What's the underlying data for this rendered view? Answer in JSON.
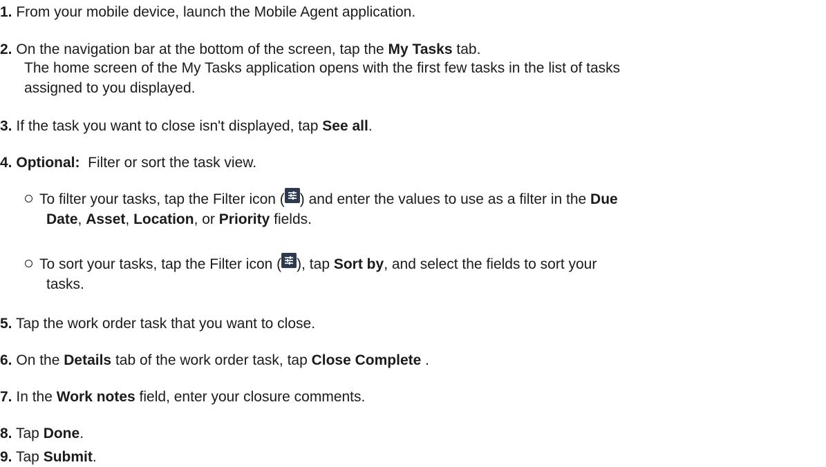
{
  "steps": [
    {
      "number": "1.",
      "parts": [
        "From your mobile device, launch the Mobile Agent application."
      ]
    },
    {
      "number": "2.",
      "pre": "On the navigation bar at the bottom of the screen, tap the ",
      "bold": "My Tasks",
      "post": " tab.",
      "cont1": "The home screen of the My Tasks application opens with the first few tasks in the list of tasks",
      "cont2": "assigned to you displayed."
    },
    {
      "number": "3.",
      "pre": "If the task you want to close isn't displayed, tap ",
      "bold": "See all",
      "post": "."
    },
    {
      "number": "4.",
      "bold": "Optional:",
      "post": "  Filter or sort the task view.",
      "sub": [
        {
          "a": "To filter your tasks, tap the Filter icon (",
          "b": ") and enter the values to use as a filter in the ",
          "b1": "Due",
          "c1": "Date",
          "c2": ", ",
          "c3": "Asset",
          "c4": ", ",
          "c5": "Location",
          "c6": ", or ",
          "c7": "Priority",
          "c8": " fields."
        },
        {
          "a": "To sort your tasks, tap the Filter icon (",
          "b": "), tap ",
          "b1": "Sort by",
          "c": ", and select the fields to sort your",
          "d": "tasks."
        }
      ]
    },
    {
      "number": "5.",
      "text": "Tap the work order task that you want to close."
    },
    {
      "number": "6.",
      "pre": "On the ",
      "bold": "Details",
      "mid": " tab of the work order task, tap ",
      "bold2": "Close Complete",
      "post": " ."
    },
    {
      "number": "7.",
      "pre": "In the ",
      "bold": "Work notes",
      "post": " field, enter your closure comments."
    },
    {
      "number": "8.",
      "pre": "Tap ",
      "bold": "Done",
      "post": "."
    },
    {
      "number": "9.",
      "pre": "Tap ",
      "bold": "Submit",
      "post": "."
    }
  ],
  "icons": {
    "filter": "filter-sliders-icon",
    "bullet": "hollow-circle-bullet"
  },
  "colors": {
    "text": "#1b1b1b",
    "icon_bg": "#2e3b4e"
  }
}
